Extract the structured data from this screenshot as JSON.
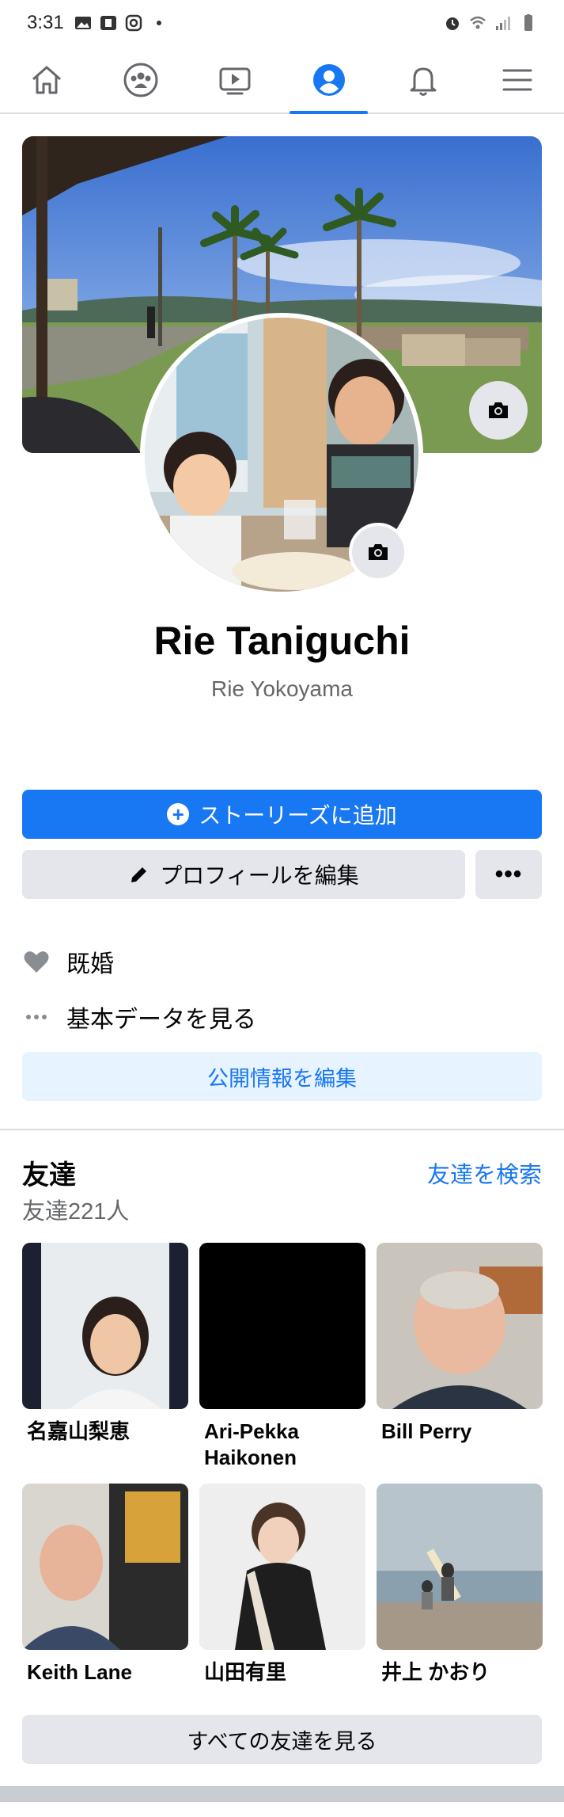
{
  "status_bar": {
    "time": "3:31",
    "left_icons": [
      "gallery-icon",
      "app-icon",
      "instagram-icon",
      "dot-icon"
    ],
    "right_icons": [
      "alarm-icon",
      "wifi-icon",
      "signal-icon",
      "battery-icon"
    ]
  },
  "nav": {
    "tabs": [
      {
        "icon": "home-icon",
        "active": false
      },
      {
        "icon": "groups-icon",
        "active": false
      },
      {
        "icon": "watch-icon",
        "active": false
      },
      {
        "icon": "profile-icon",
        "active": true
      },
      {
        "icon": "bell-icon",
        "active": false
      },
      {
        "icon": "menu-icon",
        "active": false
      }
    ],
    "accent": "#1877f2"
  },
  "profile": {
    "name": "Rie Taniguchi",
    "alternate_name": "Rie Yokoyama"
  },
  "actions": {
    "add_story": "ストーリーズに追加",
    "edit_profile": "プロフィールを編集",
    "more": "•••"
  },
  "details": {
    "relationship": "既婚",
    "see_about": "基本データを見る",
    "edit_public": "公開情報を編集"
  },
  "friends": {
    "title": "友達",
    "search": "友達を検索",
    "count": "友達221人",
    "items": [
      {
        "name": "名嘉山梨恵"
      },
      {
        "name": "Ari-Pekka Haikonen"
      },
      {
        "name": "Bill Perry"
      },
      {
        "name": "Keith Lane"
      },
      {
        "name": "山田有里"
      },
      {
        "name": "井上 かおり"
      }
    ],
    "see_all": "すべての友達を見る"
  }
}
